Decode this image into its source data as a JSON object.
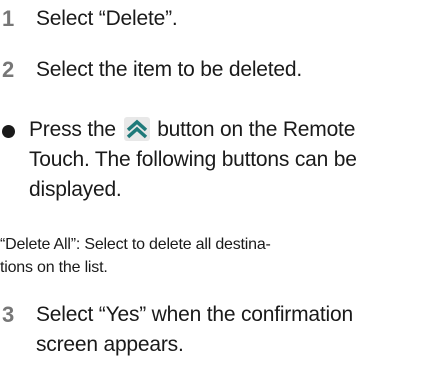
{
  "steps": [
    {
      "number": "1",
      "text": "Select “Delete”."
    },
    {
      "number": "2",
      "text": "Select the item to be deleted."
    },
    {
      "number": "3",
      "line1": "Select “Yes” when the confirmation",
      "line2": "screen appears."
    }
  ],
  "bullet": {
    "before_icon": "Press the",
    "icon_name": "double-chevron-up-icon",
    "after_icon": "button on the Remote",
    "line2": "Touch. The following buttons can be",
    "line3": "displayed."
  },
  "note": {
    "line1": "“Delete All”: Select to delete all destina-",
    "line2": "tions on the list."
  },
  "colors": {
    "step_number": "#777777",
    "text": "#1a1a1a",
    "icon_background": "#e8e8e8"
  }
}
